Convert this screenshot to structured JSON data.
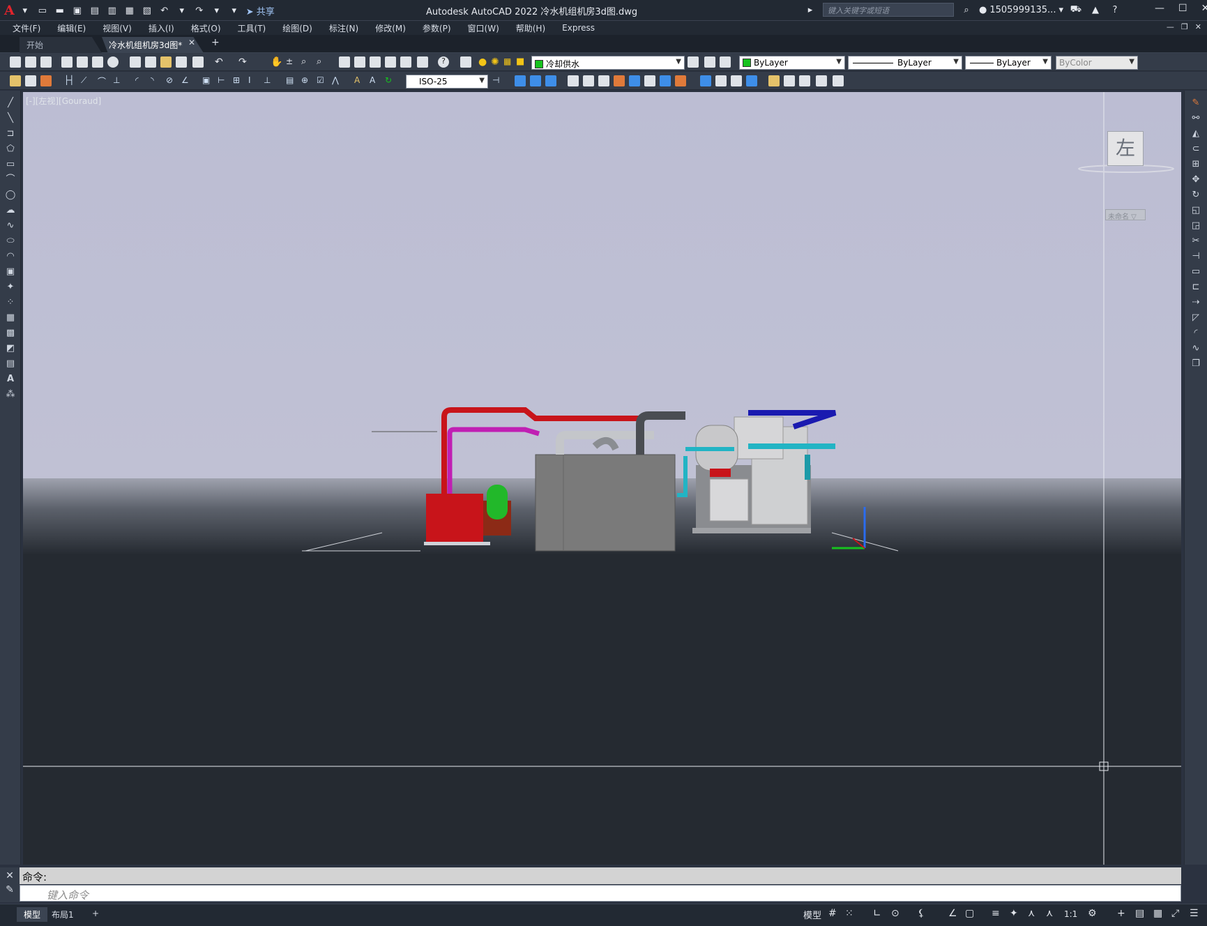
{
  "app": {
    "title": "Autodesk AutoCAD 2022    冷水机组机房3d图.dwg",
    "logo": "A",
    "share_label": "共享",
    "search_placeholder": "键入关键字或短语",
    "user": "1505999135...",
    "window_controls": [
      "—",
      "☐",
      "✕"
    ]
  },
  "menu": [
    "文件(F)",
    "编辑(E)",
    "视图(V)",
    "插入(I)",
    "格式(O)",
    "工具(T)",
    "绘图(D)",
    "标注(N)",
    "修改(M)",
    "参数(P)",
    "窗口(W)",
    "帮助(H)",
    "Express"
  ],
  "tabs": {
    "start": "开始",
    "active": "冷水机组机房3d图*",
    "close_icon": "✕",
    "add_icon": "+"
  },
  "properties": {
    "layer": "冷却供水",
    "layer_color": "#17c21f",
    "color": "ByLayer",
    "linetype": "ByLayer",
    "lineweight": "ByLayer",
    "plotstyle": "ByColor",
    "dimstyle": "ISO-25"
  },
  "viewport": {
    "label": "[-][左视][Gouraud]",
    "viewcube_face": "左",
    "ucs_menu": "未命名 ▽"
  },
  "command": {
    "history": "命令:",
    "placeholder": "键入命令"
  },
  "status": {
    "tab_model": "模型",
    "tab_layout": "布局1",
    "add": "+",
    "model_button": "模型",
    "scale": "1:1"
  },
  "colors": {
    "pipe_red": "#c8141a",
    "pipe_magenta": "#c01fb3",
    "pipe_blue": "#1a1ab0",
    "pipe_cyan": "#22b4c4",
    "tank_green": "#22b82a",
    "sky": "#bcbdd3",
    "ground": "#252a31"
  }
}
